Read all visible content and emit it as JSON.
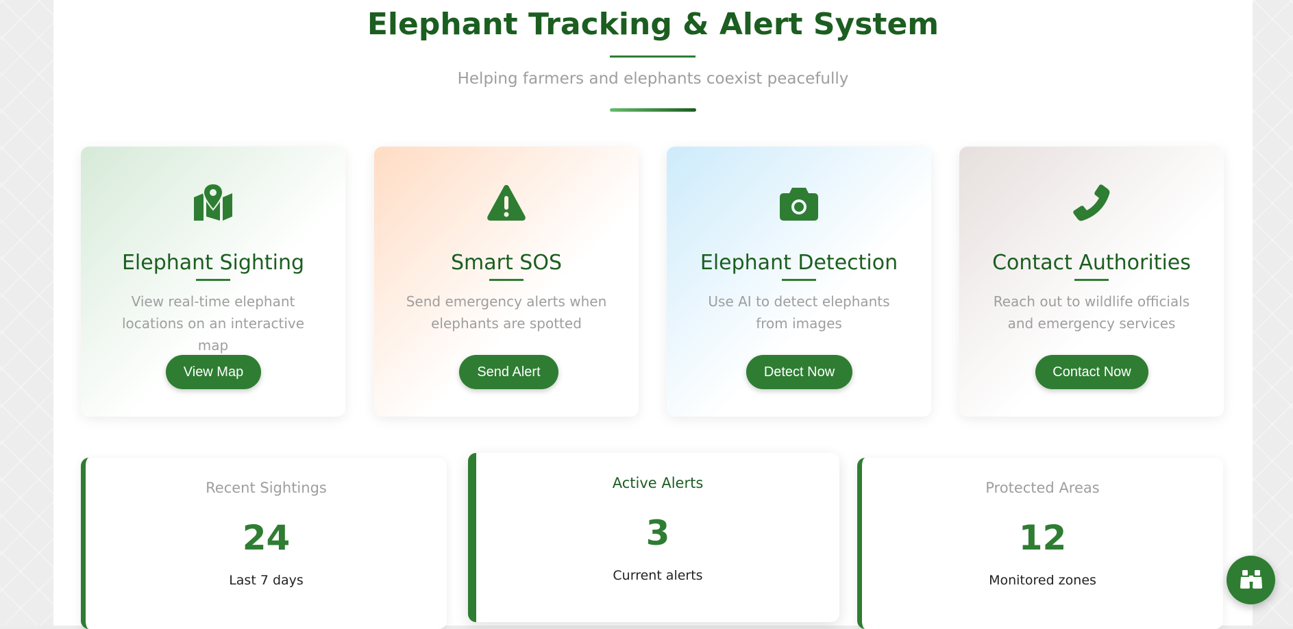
{
  "header": {
    "title": "Elephant Tracking & Alert System",
    "subtitle": "Helping farmers and elephants coexist peacefully"
  },
  "cards": [
    {
      "icon": "map-location-icon",
      "title": "Elephant Sighting",
      "description": "View real-time elephant locations on an interactive map",
      "button": "View Map"
    },
    {
      "icon": "warning-triangle-icon",
      "title": "Smart SOS",
      "description": "Send emergency alerts when elephants are spotted",
      "button": "Send Alert"
    },
    {
      "icon": "camera-icon",
      "title": "Elephant Detection",
      "description": "Use AI to detect elephants from images",
      "button": "Detect Now"
    },
    {
      "icon": "phone-icon",
      "title": "Contact Authorities",
      "description": "Reach out to wildlife officials and emergency services",
      "button": "Contact Now"
    }
  ],
  "stats": [
    {
      "label": "Recent Sightings",
      "value": "24",
      "sub": "Last 7 days"
    },
    {
      "label": "Active Alerts",
      "value": "3",
      "sub": "Current alerts"
    },
    {
      "label": "Protected Areas",
      "value": "12",
      "sub": "Monitored zones"
    }
  ],
  "fab": {
    "icon": "binoculars-icon"
  },
  "colors": {
    "primary": "#2e7d32",
    "title": "#1b5e20",
    "muted": "#9e9e9e"
  }
}
